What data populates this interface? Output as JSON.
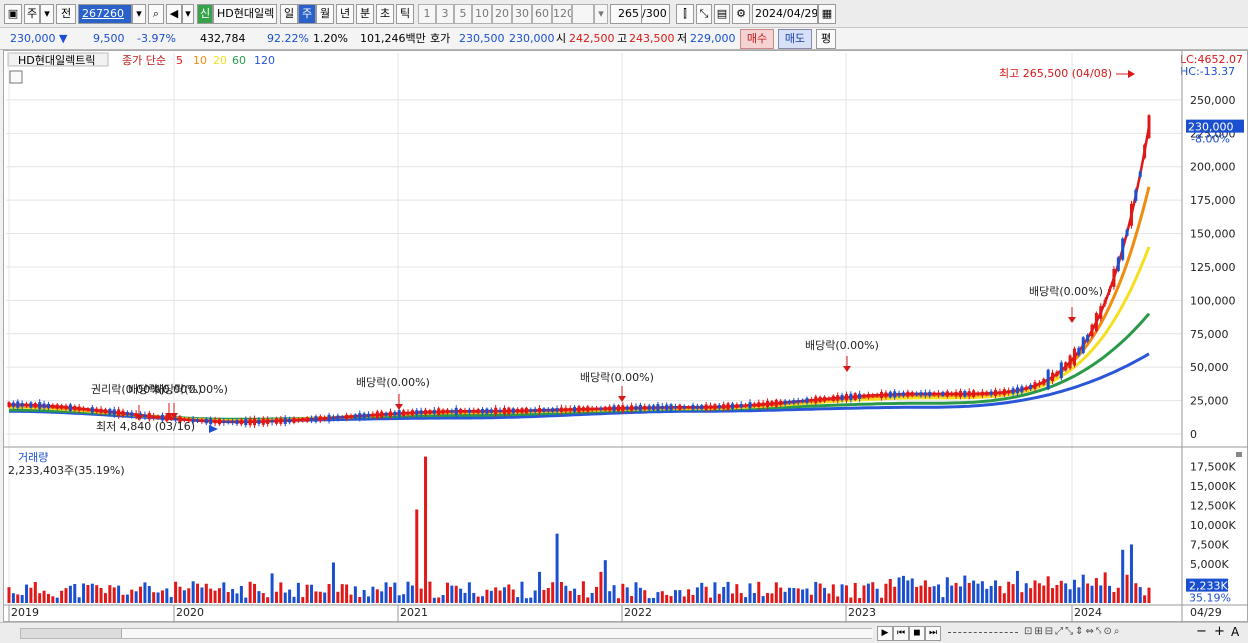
{
  "toolbar": {
    "period_btn": "주",
    "prev_btn": "전",
    "code": "267260",
    "new_badge": "신",
    "stock_name": "HD현대일렉",
    "intervals": [
      "일",
      "주",
      "월",
      "년",
      "분",
      "초",
      "틱"
    ],
    "selected_interval": "주",
    "multipliers": [
      "1",
      "3",
      "5",
      "10",
      "20",
      "30",
      "60",
      "120"
    ],
    "count": "265",
    "count_max": "/300",
    "date": "2024/04/29"
  },
  "quote": {
    "price": "230,000",
    "change": "9,500",
    "change_pct": "-3.97%",
    "volume": "432,784",
    "vol_ratio": "92.22%",
    "turnover_pct": "1.20%",
    "amount": "101,246백만",
    "bid_ask_label": "호가",
    "ask": "230,500",
    "bid": "230,000",
    "open_label": "시",
    "open": "242,500",
    "high_label": "고",
    "high": "243,500",
    "low_label": "저",
    "low": "229,000",
    "buy_btn": "매수",
    "sell_btn": "매도",
    "eval_btn": "평"
  },
  "price_panel": {
    "name_label": "HD현대일렉트릭",
    "ma_label": "종가 단순",
    "ma_periods": [
      {
        "label": "5",
        "color": "#e01818"
      },
      {
        "label": "10",
        "color": "#f08c10"
      },
      {
        "label": "20",
        "color": "#f5e020"
      },
      {
        "label": "60",
        "color": "#2a9a4a"
      },
      {
        "label": "120",
        "color": "#2a56d8"
      }
    ],
    "lc_label": "LC:4652.07",
    "hc_label": "HC:-13.37",
    "high_annotation": "최고 265,500 (04/08)",
    "low_annotation": "최저 4,840 (03/16)",
    "current_price_tag": "230,000",
    "current_pct_tag": "-8.00%",
    "events": [
      {
        "label": "권리락(0.00%)",
        "x_pct": 0.105
      },
      {
        "label": "배당락(0.00%)",
        "x_pct": 0.135
      },
      {
        "label": "배당락(0.00%)",
        "x_pct": 0.155
      },
      {
        "label": "배당락(0.00%)",
        "x_pct": 0.32
      },
      {
        "label": "배당락(0.00%)",
        "x_pct": 0.5
      },
      {
        "label": "배당락(0.00%)",
        "x_pct": 0.678
      },
      {
        "label": "배당락(0.00%)",
        "x_pct": 0.86
      }
    ],
    "y_ticks": [
      "250,000",
      "225,000",
      "200,000",
      "175,000",
      "150,000",
      "125,000",
      "100,000",
      "75,000",
      "50,000",
      "25,000",
      "0"
    ]
  },
  "volume_panel": {
    "title": "거래량",
    "value": "2,233,403주(35.19%)",
    "current_tag": "2,233K",
    "current_pct": "35.19%",
    "y_ticks": [
      "17,500K",
      "15,000K",
      "12,500K",
      "10,000K",
      "7,500K",
      "5,000K",
      "2,500K"
    ]
  },
  "x_axis": {
    "labels": [
      "2019",
      "2020",
      "2021",
      "2022",
      "2023",
      "2024"
    ],
    "last_label": "04/29"
  },
  "chart_data": {
    "type": "line",
    "title": "HD현대일렉트릭",
    "x": [
      "2019",
      "2020",
      "2021",
      "2022",
      "2023",
      "2024"
    ],
    "series": [
      {
        "name": "5",
        "values": [
          22000,
          9000,
          17000,
          20000,
          30000,
          230000
        ]
      },
      {
        "name": "10",
        "values": [
          21000,
          9500,
          16500,
          19500,
          29000,
          185000
        ]
      },
      {
        "name": "20",
        "values": [
          20000,
          10000,
          16000,
          19000,
          27000,
          140000
        ]
      },
      {
        "name": "60",
        "values": [
          18000,
          11000,
          14000,
          18500,
          23000,
          90000
        ]
      },
      {
        "name": "120",
        "values": [
          17000,
          10000,
          12000,
          17000,
          20000,
          60000
        ]
      }
    ],
    "ylim": [
      0,
      265500
    ]
  },
  "bottom_bar": {
    "buttons": [
      "▶",
      "⏮",
      "◼",
      "⏭"
    ],
    "zoom_plus": "+",
    "zoom_minus": "−",
    "font_btn": "A"
  }
}
